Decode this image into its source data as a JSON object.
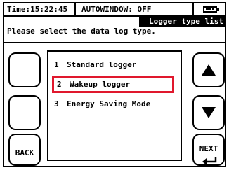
{
  "status": {
    "time": "Time:15:22:45",
    "autowindow": "AUTOWINDOW: OFF",
    "battery_icon": "battery-icon"
  },
  "screen": {
    "title": "Logger type list",
    "prompt": "Please select the data log type."
  },
  "list": {
    "items": [
      {
        "num": "1",
        "label": "Standard logger"
      },
      {
        "num": "2",
        "label": "Wakeup logger"
      },
      {
        "num": "3",
        "label": "Energy Saving Mode"
      }
    ],
    "selected_index": 1
  },
  "buttons": {
    "back": "BACK",
    "next": "NEXT",
    "up_icon": "up-arrow-icon",
    "down_icon": "down-arrow-icon",
    "enter_icon": "enter-icon"
  },
  "colors": {
    "selection": "#e0182d",
    "foreground": "#000000",
    "background": "#ffffff"
  }
}
